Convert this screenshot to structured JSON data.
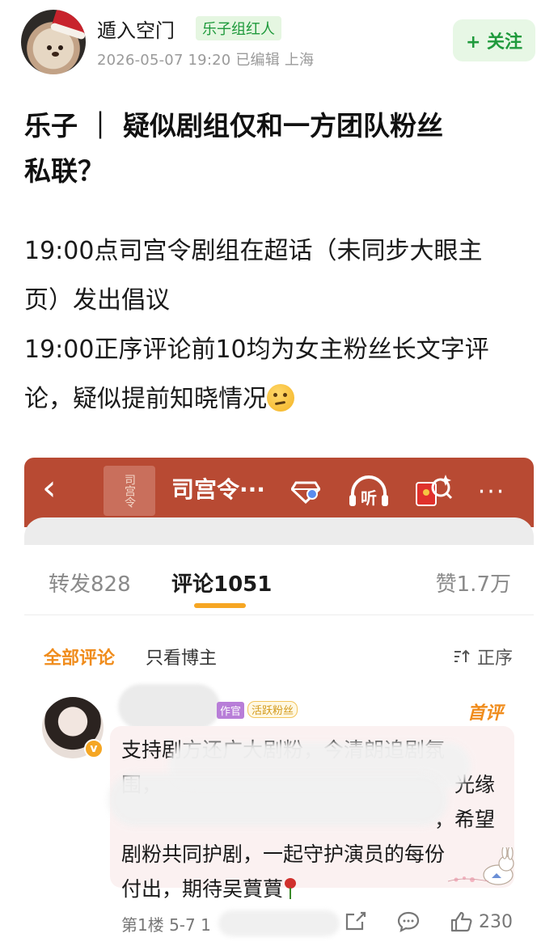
{
  "post": {
    "author": "遁入空门",
    "author_badge": "乐子组红人",
    "meta": "2026-05-07 19:20  已编辑  上海",
    "follow_label": "+ 关注",
    "title_line1": "乐子 ｜ 疑似剧组仅和一方团队粉丝",
    "title_line2": "私联？",
    "body_line1": "19:00点司宫令剧组在超话（未同步大眼主",
    "body_line2": "页）发出倡议",
    "body_line3": "19:00正序评论前10均为女主粉丝长文字评",
    "body_line4": "论，疑似提前知晓情况"
  },
  "screenshot": {
    "back_glyph": "‹",
    "logo_text": "司宫令",
    "title": "司宫令···",
    "listen_label": "听",
    "more_glyph": "···",
    "tabs": {
      "repost": "转发828",
      "comments": "评论1051",
      "likes": "赞1.7万"
    },
    "filters": {
      "all": "全部评论",
      "owner_only": "只看博主",
      "sort": "正序"
    },
    "comment": {
      "badge_role": "作官",
      "badge_fan": "活跃粉丝",
      "first_label": "首评",
      "line1": "支持剧方还广大剧粉，今清朗追剧氛",
      "line2": "围，",
      "line2_tail": "光缘",
      "line3_tail": "，希望",
      "line4": "剧粉共同护剧，一起守护演员的每份",
      "line5": "付出，期待吴蕒蕒",
      "floor": "第1楼  5-7  1",
      "likes_count": "230"
    }
  },
  "icons": [
    "thinking-face-icon",
    "back-icon",
    "diamond-icon",
    "headphones-icon",
    "red-packet-icon",
    "more-icon",
    "sort-icon",
    "share-icon",
    "comment-icon",
    "like-icon",
    "verified-icon",
    "rose-icon"
  ],
  "colors": {
    "brand_green": "#1f9a3c",
    "weibo_orange": "#f08c1c",
    "topbar_red": "#b84a33"
  }
}
